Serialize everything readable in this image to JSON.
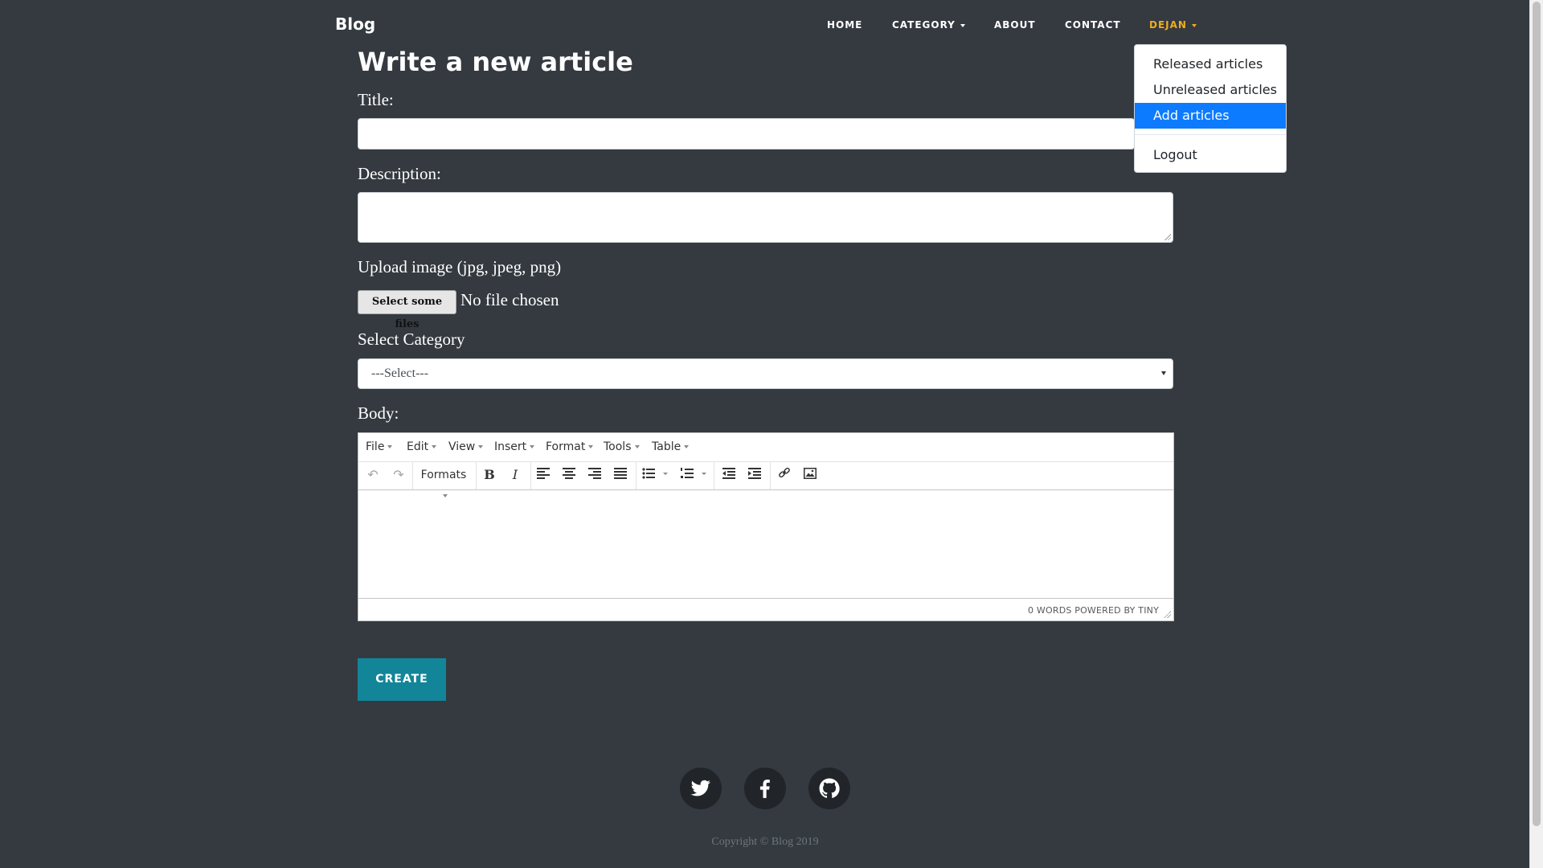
{
  "navbar": {
    "brand": "Blog",
    "items": [
      {
        "label": "HOME"
      },
      {
        "label": "CATEGORY"
      },
      {
        "label": "ABOUT"
      },
      {
        "label": "CONTACT"
      },
      {
        "label": "DEJAN"
      }
    ]
  },
  "user_menu": {
    "items": [
      "Released articles",
      "Unreleased articles",
      "Add articles",
      "Logout"
    ],
    "selected": "Add articles"
  },
  "form": {
    "heading": "Write a new article",
    "title_label": "Title:",
    "title_value": "",
    "description_label": "Description:",
    "description_value": "",
    "upload_label": "Upload image (jpg, jpeg, png)",
    "file_button": "Select some files",
    "file_status": "No file chosen",
    "category_label": "Select Category",
    "category_value": "---Select---",
    "body_label": "Body:",
    "create_button": "CREATE"
  },
  "editor": {
    "menus": [
      "File",
      "Edit",
      "View",
      "Insert",
      "Format",
      "Tools",
      "Table"
    ],
    "formats_label": "Formats",
    "status": "0 WORDS POWERED BY TINY",
    "icons": [
      "undo-icon",
      "redo-icon",
      "bold-icon",
      "italic-icon",
      "align-left-icon",
      "align-center-icon",
      "align-right-icon",
      "align-justify-icon",
      "bullet-list-icon",
      "numbered-list-icon",
      "outdent-icon",
      "indent-icon",
      "link-icon",
      "image-icon"
    ]
  },
  "footer": {
    "social": [
      "twitter-icon",
      "facebook-icon",
      "github-icon"
    ],
    "copyright": "Copyright © Blog 2019"
  },
  "colors": {
    "background": "#343a40",
    "active_nav": "#f0ad1c",
    "selected_item": "#0d7bff",
    "create_button": "#128599",
    "social_circle": "#212529"
  }
}
